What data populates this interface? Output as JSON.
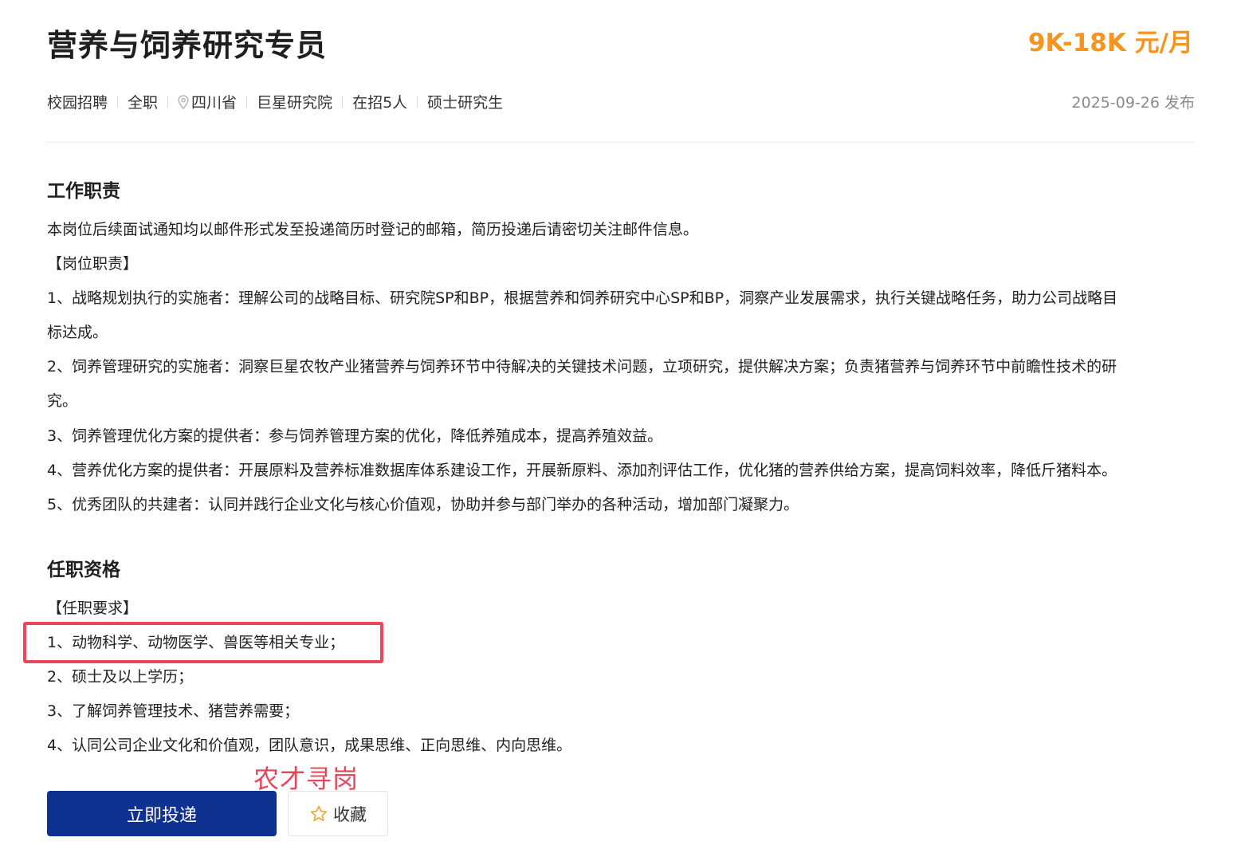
{
  "job": {
    "title": "营养与饲养研究专员",
    "salary": "9K-18K 元/月"
  },
  "meta": {
    "recruit_type": "校园招聘",
    "employment_type": "全职",
    "location": "四川省",
    "company": "巨星研究院",
    "headcount": "在招5人",
    "education": "硕士研究生",
    "publish_date": "2025-09-26 发布",
    "location_icon": "map-pin-icon"
  },
  "duties": {
    "heading": "工作职责",
    "lines": [
      "本岗位后续面试通知均以邮件形式发至投递简历时登记的邮箱，简历投递后请密切关注邮件信息。",
      "【岗位职责】",
      "1、战略规划执行的实施者：理解公司的战略目标、研究院SP和BP，根据营养和饲养研究中心SP和BP，洞察产业发展需求，执行关键战略任务，助力公司战略目",
      "标达成。",
      "2、饲养管理研究的实施者：洞察巨星农牧产业猪营养与饲养环节中待解决的关键技术问题，立项研究，提供解决方案；负责猪营养与饲养环节中前瞻性技术的研",
      "究。",
      "3、饲养管理优化方案的提供者：参与饲养管理方案的优化，降低养殖成本，提高养殖效益。",
      "4、营养优化方案的提供者：开展原料及营养标准数据库体系建设工作，开展新原料、添加剂评估工作，优化猪的营养供给方案，提高饲料效率，降低斤猪料本。",
      "5、优秀团队的共建者：认同并践行企业文化与核心价值观，协助并参与部门举办的各种活动，增加部门凝聚力。"
    ]
  },
  "qualifications": {
    "heading": "任职资格",
    "lines": [
      "【任职要求】",
      "1、动物科学、动物医学、兽医等相关专业；",
      "2、硕士及以上学历；",
      "3、了解饲养管理技术、猪营养需要；",
      "4、认同公司企业文化和价值观，团队意识，成果思维、正向思维、内向思维。"
    ]
  },
  "watermark": "农才寻岗",
  "actions": {
    "apply_label": "立即投递",
    "favorite_label": "收藏",
    "favorite_icon": "star-outline-icon"
  },
  "colors": {
    "salary": "#f7941d",
    "primary_button": "#0f3190",
    "highlight": "#ea4758",
    "watermark": "#e5475a",
    "star": "#f5a623"
  }
}
